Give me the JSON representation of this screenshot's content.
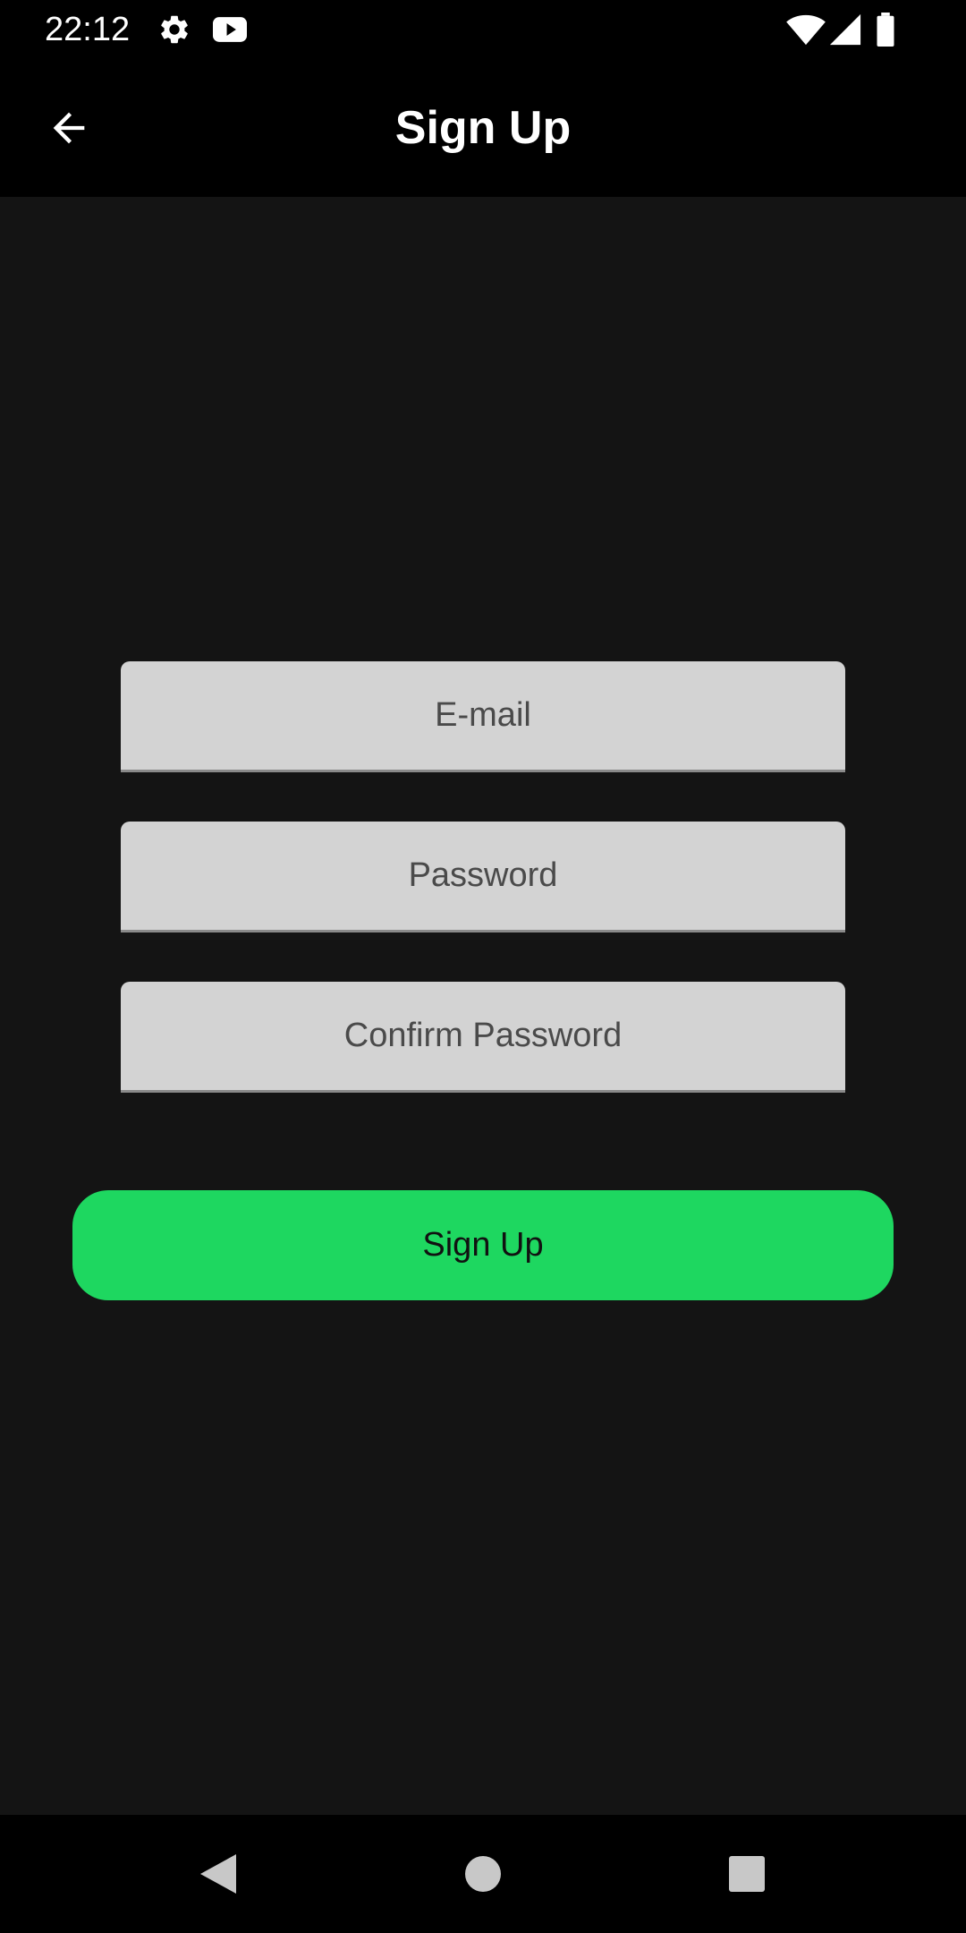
{
  "status_bar": {
    "time": "22:12",
    "icons": [
      "gear-icon",
      "youtube-icon",
      "wifi-icon",
      "cell-signal-icon",
      "battery-icon"
    ]
  },
  "app_bar": {
    "title": "Sign Up",
    "back_icon": "arrow-left-icon"
  },
  "form": {
    "email_placeholder": "E-mail",
    "password_placeholder": "Password",
    "confirm_placeholder": "Confirm Password",
    "email_value": "",
    "password_value": "",
    "confirm_value": "",
    "submit_label": "Sign Up"
  },
  "nav_bar": {
    "icons": [
      "back-triangle-icon",
      "home-circle-icon",
      "recents-square-icon"
    ]
  },
  "colors": {
    "background": "#141414",
    "bar": "#000000",
    "input_bg": "#d3d3d3",
    "accent": "#1ed760"
  }
}
